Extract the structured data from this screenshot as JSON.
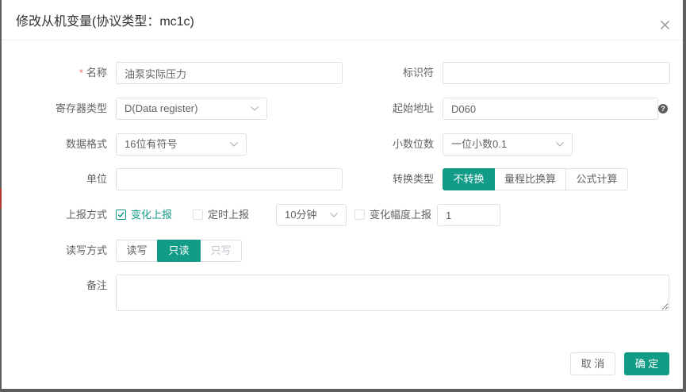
{
  "dialog": {
    "title": "修改从机变量(协议类型：mc1c)"
  },
  "form": {
    "name": {
      "required_mark": "*",
      "label": "名称",
      "value": "油泵实际压力"
    },
    "identifier": {
      "label": "标识符",
      "value": ""
    },
    "register_type": {
      "label": "寄存器类型",
      "value": "D(Data register)"
    },
    "start_address": {
      "label": "起始地址",
      "value": "D060",
      "help_icon": "question-circle-icon",
      "help_glyph": "?"
    },
    "data_format": {
      "label": "数据格式",
      "value": "16位有符号"
    },
    "decimal_places": {
      "label": "小数位数",
      "value": "一位小数0.1"
    },
    "unit": {
      "label": "单位",
      "value": ""
    },
    "conversion_type": {
      "label": "转换类型",
      "options": [
        {
          "label": "不转换",
          "active": true
        },
        {
          "label": "量程比换算",
          "active": false
        },
        {
          "label": "公式计算",
          "active": false
        }
      ]
    },
    "report_mode": {
      "label": "上报方式",
      "change_report": {
        "label": "变化上报",
        "checked": true
      },
      "timed_report": {
        "label": "定时上报",
        "checked": false
      },
      "interval": {
        "value": "10分钟"
      },
      "amplitude_report": {
        "label": "变化幅度上报",
        "checked": false
      },
      "amplitude_value": "1"
    },
    "rw_mode": {
      "label": "读写方式",
      "options": [
        {
          "label": "读写",
          "active": false,
          "disabled": false
        },
        {
          "label": "只读",
          "active": true,
          "disabled": false
        },
        {
          "label": "只写",
          "active": false,
          "disabled": true
        }
      ]
    },
    "remark": {
      "label": "备注",
      "value": ""
    }
  },
  "footer": {
    "cancel_label": "取 消",
    "confirm_label": "确 定"
  },
  "colors": {
    "primary": "#129c88",
    "required": "#f56c6c"
  }
}
